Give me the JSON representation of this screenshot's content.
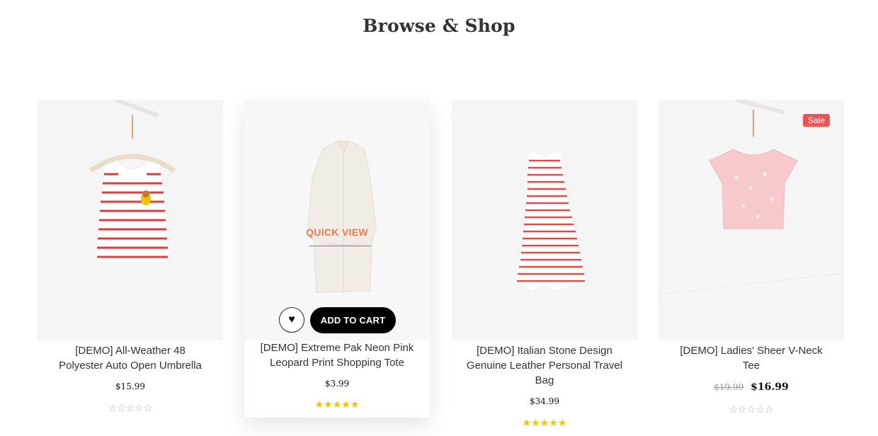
{
  "heading": "Browse & Shop",
  "hover_actions": {
    "quick_view": "QUICK VIEW",
    "add_to_cart": "ADD TO CART",
    "wishlist_icon": "heart-icon"
  },
  "products": [
    {
      "name": "[DEMO] All-Weather 48 Polyester Auto Open Umbrella",
      "price": "$15.99",
      "rating": "☆☆☆☆☆",
      "image": "striped-tank-top",
      "colors": {
        "stripe": "#e23b3b",
        "base": "#ffffff"
      }
    },
    {
      "name": "[DEMO] Extreme Pak Neon Pink Leopard Print Shopping Tote",
      "price": "$3.99",
      "rating": "★★★★★",
      "image": "white-shirt-dress"
    },
    {
      "name": "[DEMO] Italian Stone Design Genuine Leather Personal Travel Bag",
      "price": "$34.99",
      "rating": "★★★★★",
      "image": "striped-dress"
    },
    {
      "name": "[DEMO] Ladies' Sheer V-Neck Tee",
      "old_price": "$19.99",
      "price": "$16.99",
      "sale_label": "Sale",
      "rating": "☆☆☆☆☆",
      "image": "pink-knit-top"
    }
  ],
  "colors": {
    "accent": "#ef7a52",
    "sale": "#ef5152",
    "star": "#f2c200",
    "button": "#000000"
  }
}
